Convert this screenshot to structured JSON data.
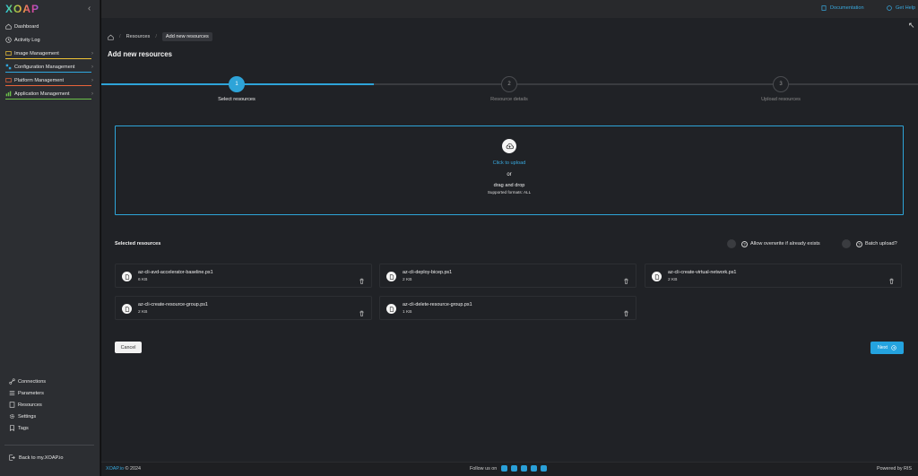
{
  "app": {
    "logo": "XOAP"
  },
  "sidebar": {
    "items": [
      {
        "label": "Dashboard",
        "icon": "home-icon",
        "color": ""
      },
      {
        "label": "Activity Log",
        "icon": "clock-icon",
        "color": ""
      },
      {
        "label": "Image Management",
        "icon": "image-icon",
        "color": "#f0c437"
      },
      {
        "label": "Configuration Management",
        "icon": "config-icon",
        "color": "#2fa8e0"
      },
      {
        "label": "Platform Management",
        "icon": "platform-icon",
        "color": "#e9643a"
      },
      {
        "label": "Application Management",
        "icon": "apps-icon",
        "color": "#6cc24a"
      }
    ],
    "bottom_items": [
      {
        "label": "Connections",
        "icon": "link-icon"
      },
      {
        "label": "Parameters",
        "icon": "list-icon"
      },
      {
        "label": "Resources",
        "icon": "resources-icon"
      },
      {
        "label": "Settings",
        "icon": "gear-icon"
      },
      {
        "label": "Tags",
        "icon": "tag-icon"
      }
    ],
    "back_label": "Back to my.XOAP.io"
  },
  "topbar": {
    "documentation": "Documentation",
    "help": "Get Help"
  },
  "breadcrumb": {
    "items": [
      "Resources",
      "Add new resources"
    ]
  },
  "page": {
    "title": "Add new resources"
  },
  "stepper": {
    "steps": [
      {
        "number": "1",
        "label": "Select resources",
        "active": true
      },
      {
        "number": "2",
        "label": "Resource details",
        "active": false
      },
      {
        "number": "3",
        "label": "Upload resources",
        "active": false
      }
    ],
    "accent": "#2ea4d8"
  },
  "dropzone": {
    "click_text": "Click to upload",
    "or_text": "or",
    "drag_text": "drag and drop",
    "formats": "Supported formats: ALL"
  },
  "selected": {
    "title": "Selected resources",
    "allow_overwrite": "Allow overwrite if already exists",
    "batch_upload": "Batch upload?",
    "files": [
      {
        "name": "az-cli-avd-accelerator-baseline.ps1",
        "size": "6 KB"
      },
      {
        "name": "az-cli-deploy-bicep.ps1",
        "size": "2 KB"
      },
      {
        "name": "az-cli-create-virtual-network.ps1",
        "size": "2 KB"
      },
      {
        "name": "az-cli-create-resource-group.ps1",
        "size": "2 KB"
      },
      {
        "name": "az-cli-delete-resource-group.ps1",
        "size": "1 KB"
      }
    ]
  },
  "actions": {
    "cancel": "Cancel",
    "next": "Next"
  },
  "footer": {
    "brand": "XOAP.io",
    "copyright": "© 2024",
    "follow": "Follow us on",
    "powered": "Powered by RIS"
  }
}
